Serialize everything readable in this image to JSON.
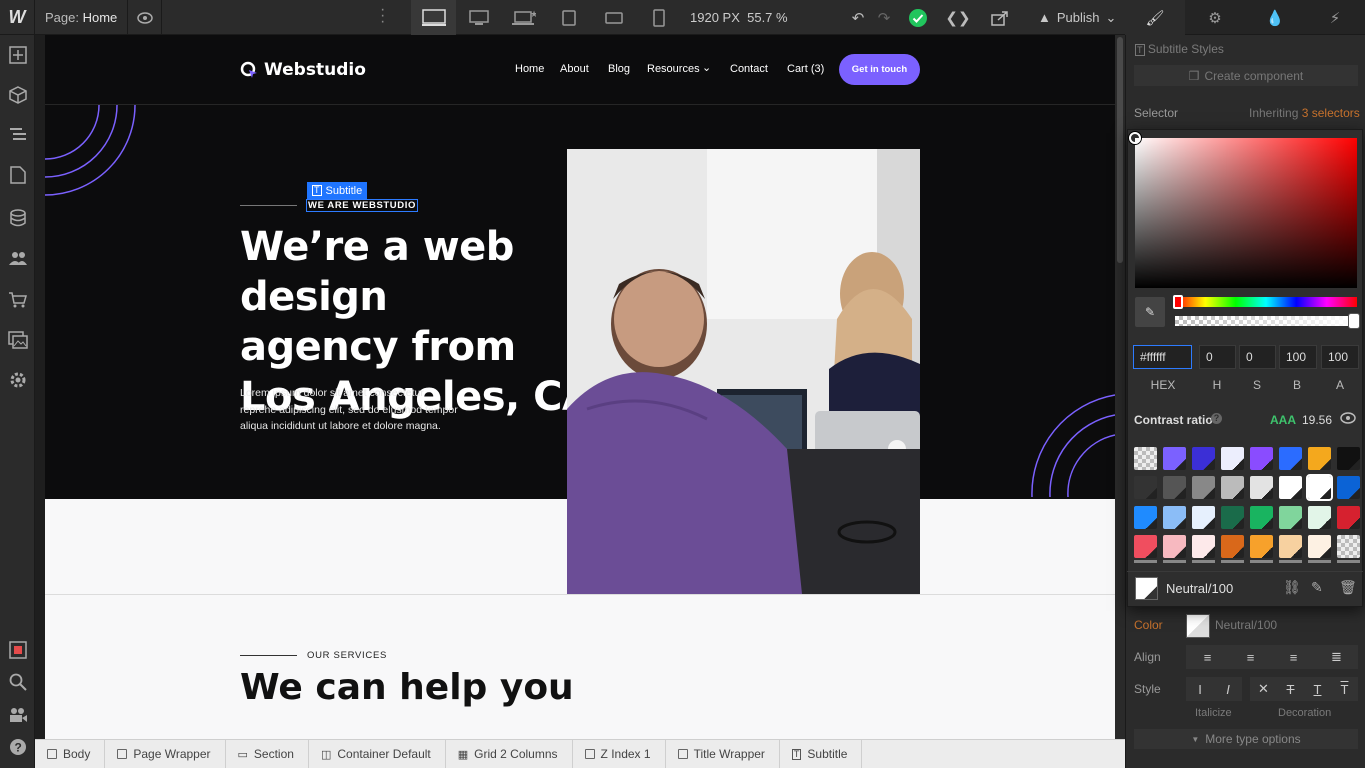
{
  "topbar": {
    "logo": "W",
    "page_prefix": "Page:",
    "page_name": "Home",
    "width_readout": "1920 PX",
    "zoom": "55.7 %",
    "publish_label": "Publish"
  },
  "canvas": {
    "brand_name": "Webstudio",
    "nav": [
      "Home",
      "About",
      "Blog",
      "Resources",
      "Contact",
      "Cart (3)"
    ],
    "cta_label": "Get in touch",
    "selection_tag": "Subtitle",
    "subtitle": "WE ARE WEBSTUDIO",
    "headline_line1": "We’re a web design",
    "headline_line2": "agency from",
    "headline_line3": "Los Angeles, CA",
    "hero_desc_line1": "Lorem ipsum dolor sit amet consectetur",
    "hero_desc_line2": "reprehe adipiscing elit, sed do elusmod tempor",
    "hero_desc_line3": "aliqua incididunt ut labore et dolore magna.",
    "services_label": "OUR SERVICES",
    "services_title": "We can help you"
  },
  "breadcrumbs": [
    "Body",
    "Page Wrapper",
    "Section",
    "Container Default",
    "Grid 2 Columns",
    "Z Index 1",
    "Title Wrapper",
    "Subtitle"
  ],
  "right_panel": {
    "style_title": "Subtitle Styles",
    "create_component": "Create component",
    "selector_label": "Selector",
    "inheriting_prefix": "Inheriting",
    "inheriting_count": "3 selectors",
    "color_label": "Color",
    "color_value": "Neutral/100",
    "align_label": "Align",
    "style_label": "Style",
    "italicize_label": "Italicize",
    "decoration_label": "Decoration",
    "more_type": "More type options"
  },
  "picker": {
    "hex": "#ffffff",
    "h": "0",
    "s": "0",
    "b": "100",
    "a": "100",
    "labels": [
      "HEX",
      "H",
      "S",
      "B",
      "A"
    ],
    "contrast_label": "Contrast ratio",
    "contrast_grade": "AAA",
    "contrast_value": "19.56",
    "swatch_name": "Neutral/100",
    "accent": "#1f75ff",
    "swatches": [
      "checker",
      "#7b61ff",
      "#3b2fd6",
      "#eceefd",
      "#8a4cff",
      "#2b6cff",
      "#f4a81d",
      "#111111",
      "#333333",
      "#555555",
      "#888888",
      "#bbbbbb",
      "#e3e3e3",
      "#ffffff",
      "#ffffff",
      "#0b63d6",
      "#1f8bff",
      "#8bbdf7",
      "#e6f0fd",
      "#1a6b4a",
      "#19b460",
      "#80d59c",
      "#e2f5e8",
      "#d6212f",
      "#f04e5f",
      "#f7b9c0",
      "#fde9ea",
      "#d9681a",
      "#f7a12b",
      "#f7d1a0",
      "#fdf1e3",
      "checker"
    ]
  }
}
